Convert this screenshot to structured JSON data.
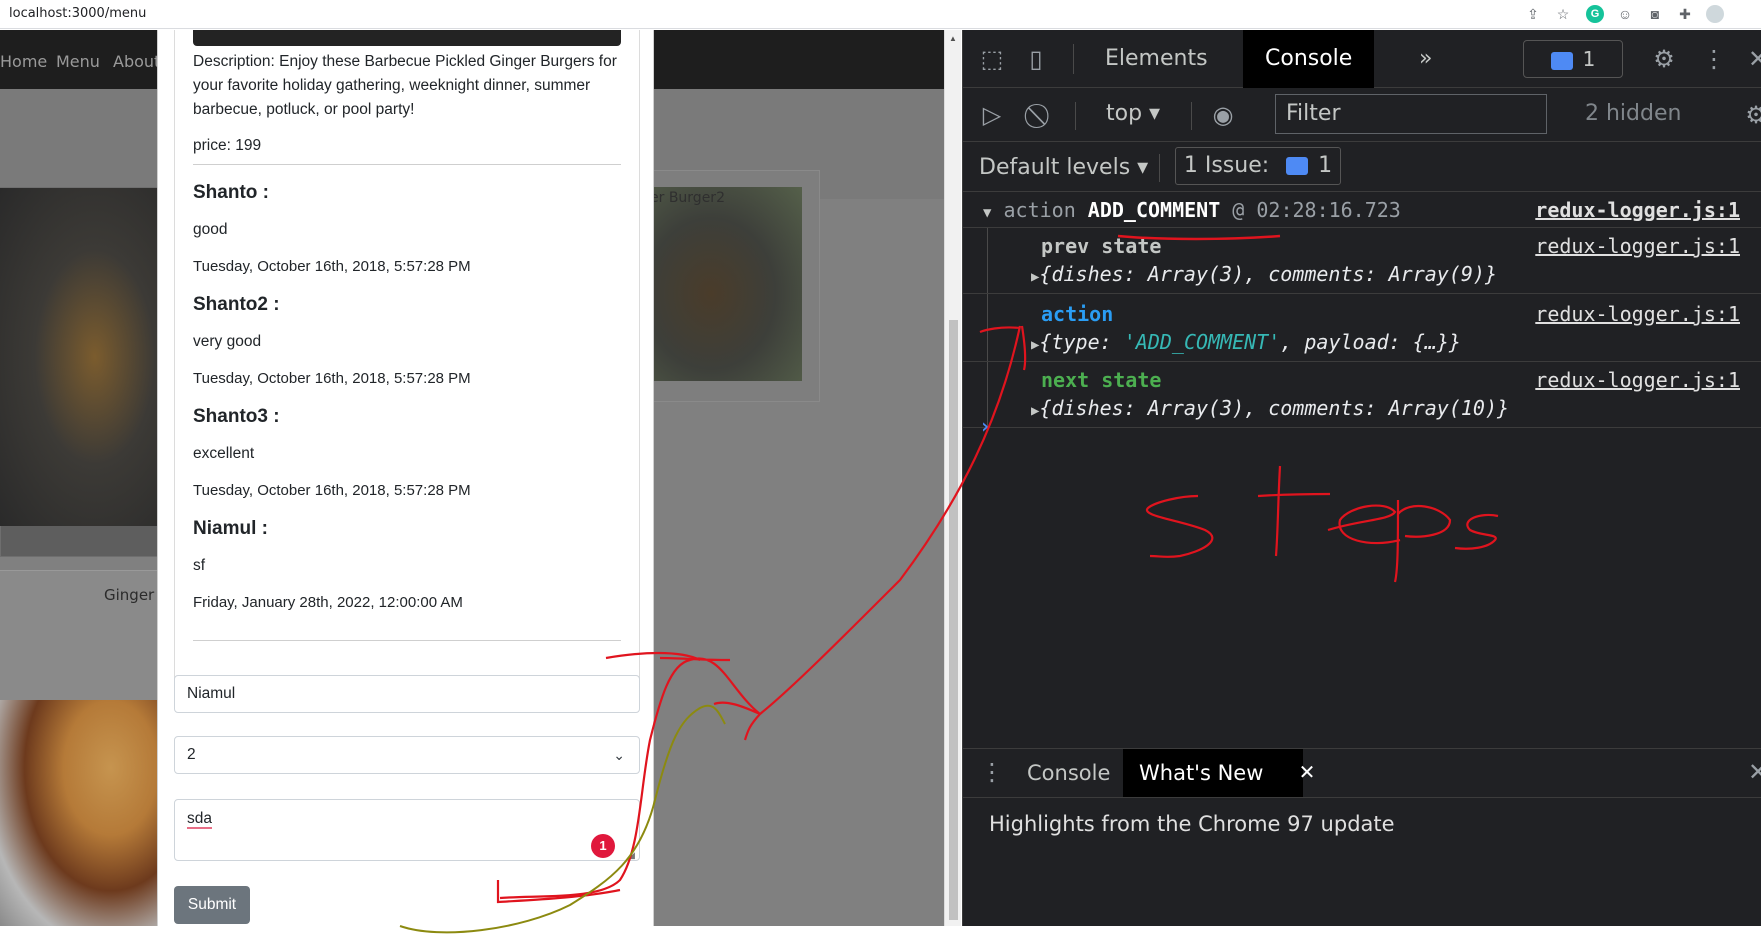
{
  "browser": {
    "url": "localhost:3000/menu",
    "icons": [
      "share-icon",
      "star-icon",
      "grammarly-icon",
      "extension-face-icon",
      "camera-icon",
      "puzzle-icon",
      "profile-icon"
    ],
    "grammarly_letter": "G"
  },
  "site": {
    "nav": [
      "Home",
      "Menu",
      "About"
    ],
    "card_caption_right": "er Burger2",
    "card_caption_left": "Ginger"
  },
  "modal": {
    "description": "Description: Enjoy these Barbecue Pickled Ginger Burgers for your favorite holiday gathering, weeknight dinner, summer barbecue, potluck, or pool party!",
    "price": "price: 199",
    "comments": [
      {
        "author": "Shanto :",
        "text": "good",
        "date": "Tuesday, October 16th, 2018, 5:57:28 PM"
      },
      {
        "author": "Shanto2 :",
        "text": "very good",
        "date": "Tuesday, October 16th, 2018, 5:57:28 PM"
      },
      {
        "author": "Shanto3 :",
        "text": "excellent",
        "date": "Tuesday, October 16th, 2018, 5:57:28 PM"
      },
      {
        "author": "Niamul :",
        "text": "sf",
        "date": "Friday, January 28th, 2022, 12:00:00 AM"
      }
    ],
    "form": {
      "author_value": "Niamul",
      "rating_value": "2",
      "comment_value": "sda",
      "grammarly_count": "1",
      "submit_label": "Submit"
    }
  },
  "devtools": {
    "tabs": [
      "Elements",
      "Console"
    ],
    "active_tab": "Console",
    "more_tabs": "»",
    "issues_count": "1",
    "context": "top",
    "filter_placeholder": "Filter",
    "hidden_count": "2 hidden",
    "levels": "Default levels",
    "issue_label": "1 Issue:",
    "issue_count": "1",
    "log": {
      "header_prefix": "action ",
      "header_action": "ADD_COMMENT",
      "header_time": " @ 02:28:16.723",
      "source": "redux-logger.js:1",
      "prev_label": "prev state",
      "prev_value": "{dishes: Array(3), comments: Array(9)}",
      "action_label": "action",
      "action_value_a": "{type: ",
      "action_value_b": "'ADD_COMMENT'",
      "action_value_c": ", payload: {…}}",
      "next_label": "next state",
      "next_value": "{dishes: Array(3), comments: Array(10)}"
    },
    "prompt": "›",
    "drawer_tabs": [
      "Console",
      "What's New"
    ],
    "drawer_active": "What's New",
    "drawer_text": "Highlights from the Chrome 97 update"
  },
  "colors": {
    "accent_blue": "#4e8af4",
    "log_action_blue": "#2a9df4",
    "log_next_green": "#4caf50",
    "string_orange": "#36b8b5",
    "ink_red": "#e0141e",
    "ink_olive": "#8c8a10"
  }
}
